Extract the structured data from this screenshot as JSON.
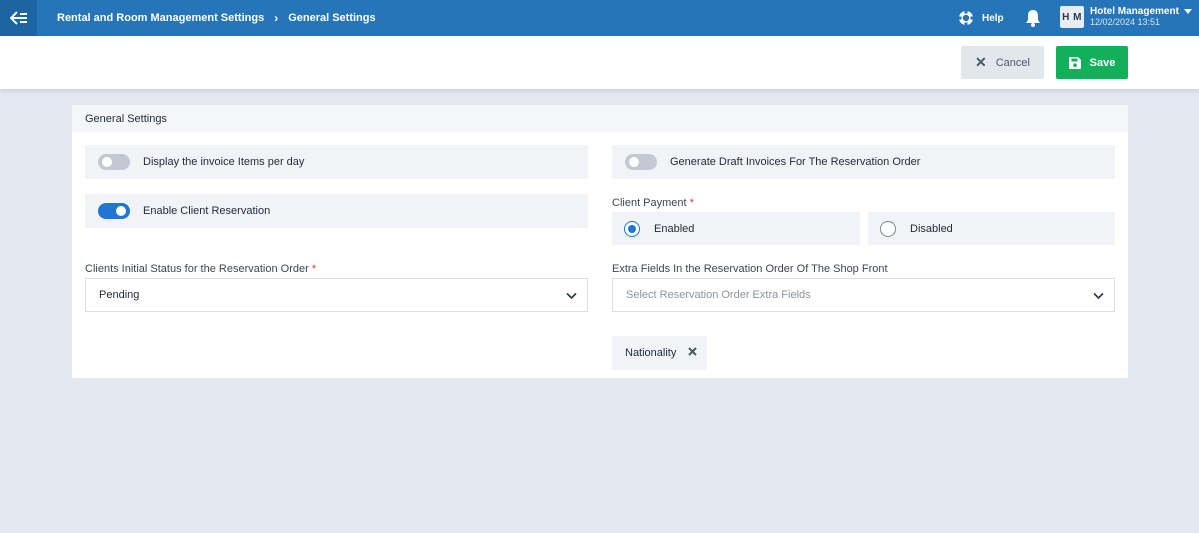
{
  "header": {
    "breadcrumbs": [
      "Rental and Room Management Settings",
      "General Settings"
    ],
    "help_label": "Help",
    "user": {
      "initials": "H M",
      "name": "Hotel Management",
      "datetime": "12/02/2024 13:51"
    }
  },
  "actions": {
    "cancel_label": "Cancel",
    "save_label": "Save"
  },
  "panel": {
    "title": "General Settings",
    "toggles": [
      {
        "label": "Display the invoice Items per day",
        "on": false
      },
      {
        "label": "Generate Draft Invoices For The Reservation Order",
        "on": false
      },
      {
        "label": "Enable Client Reservation",
        "on": true
      }
    ],
    "client_payment": {
      "label": "Client Payment",
      "required_mark": "*",
      "options": [
        {
          "label": "Enabled",
          "selected": true
        },
        {
          "label": "Disabled",
          "selected": false
        }
      ]
    },
    "initial_status": {
      "label": "Clients Initial Status for the Reservation Order",
      "required_mark": "*",
      "value": "Pending"
    },
    "extra_fields": {
      "label": "Extra Fields In the Reservation Order Of The Shop Front",
      "placeholder": "Select Reservation Order Extra Fields",
      "selected_tags": [
        "Nationality"
      ]
    }
  },
  "colors": {
    "topbar": "#2575b8",
    "accent": "#1f76d6",
    "save": "#13b05b",
    "background": "#e4e9f1"
  }
}
